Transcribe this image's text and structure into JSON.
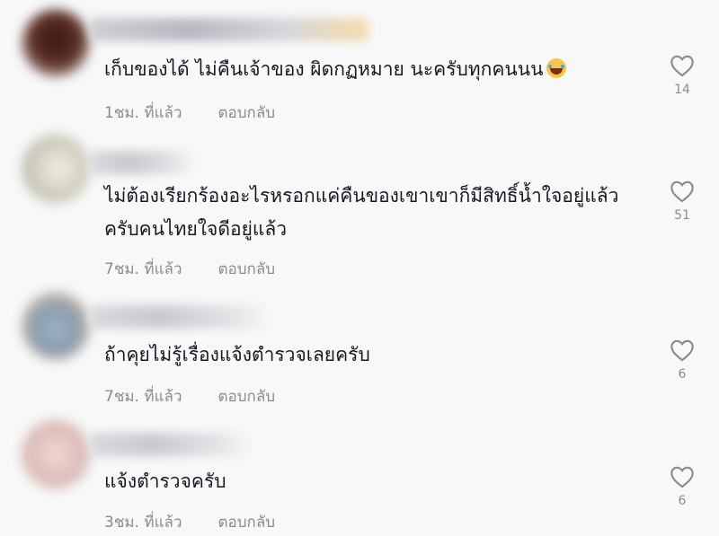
{
  "comments": [
    {
      "text": "เก็บของได้ ไม่คืนเจ้าของ ผิดกฏหมาย นะครับทุกคนนน",
      "emoji": "laughing-with-tears",
      "time": "1ชม. ที่แล้ว",
      "reply_label": "ตอบกลับ",
      "likes": "14"
    },
    {
      "text": "ไม่ต้องเรียกร้องอะไรหรอกแค่คืนของเขาเขาก็มีสิทธิ์น้ำใจอยู่แล้วครับคนไทยใจดีอยู่แล้ว",
      "time": "7ชม. ที่แล้ว",
      "reply_label": "ตอบกลับ",
      "likes": "51"
    },
    {
      "text": "ถ้าคุยไม่รู้เรื่องแจ้งตำรวจเลยครับ",
      "time": "7ชม. ที่แล้ว",
      "reply_label": "ตอบกลับ",
      "likes": "6"
    },
    {
      "text": "แจ้งตำรวจครับ",
      "time": "3ชม. ที่แล้ว",
      "reply_label": "ตอบกลับ",
      "likes": "6"
    }
  ],
  "icons": {
    "like": "heart-outline-icon"
  },
  "colors": {
    "text": "#161823",
    "muted": "#8a8b91",
    "background": "#f8f8f8"
  }
}
